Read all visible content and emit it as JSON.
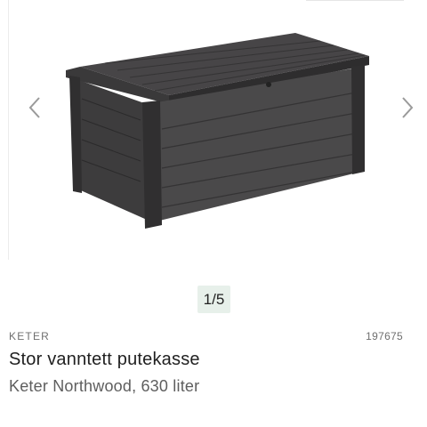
{
  "gallery": {
    "pager_text": "1/5",
    "prev_icon": "chevron-left-icon",
    "next_icon": "chevron-right-icon"
  },
  "product": {
    "brand": "KETER",
    "sku": "197675",
    "title": "Stor vanntett putekasse",
    "subtitle": "Keter Northwood, 630 liter"
  },
  "colors": {
    "pager_background": "#e7f0ea",
    "product_dark": "#3b3a3b"
  }
}
